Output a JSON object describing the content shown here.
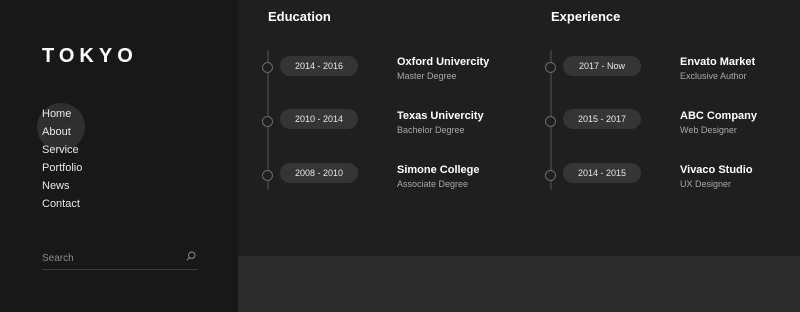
{
  "logo": "TOKYO",
  "nav": [
    "Home",
    "About",
    "Service",
    "Portfolio",
    "News",
    "Contact"
  ],
  "search": {
    "placeholder": "Search"
  },
  "education": {
    "title": "Education",
    "items": [
      {
        "years": "2014 - 2016",
        "title": "Oxford Univercity",
        "subtitle": "Master Degree"
      },
      {
        "years": "2010 - 2014",
        "title": "Texas Univercity",
        "subtitle": "Bachelor Degree"
      },
      {
        "years": "2008 - 2010",
        "title": "Simone College",
        "subtitle": "Associate Degree"
      }
    ]
  },
  "experience": {
    "title": "Experience",
    "items": [
      {
        "years": "2017 - Now",
        "title": "Envato Market",
        "subtitle": "Exclusive Author"
      },
      {
        "years": "2015 - 2017",
        "title": "ABC Company",
        "subtitle": "Web Designer"
      },
      {
        "years": "2014 - 2015",
        "title": "Vivaco Studio",
        "subtitle": "UX Designer"
      }
    ]
  }
}
